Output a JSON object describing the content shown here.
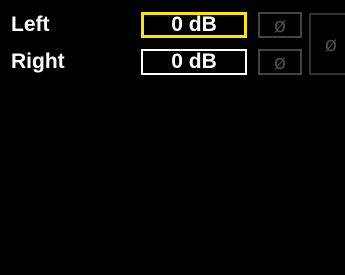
{
  "channels": {
    "left": {
      "label": "Left",
      "gain": "0 dB",
      "phase_symbol": "ø"
    },
    "right": {
      "label": "Right",
      "gain": "0 dB",
      "phase_symbol": "ø"
    }
  },
  "phase_all": {
    "symbol": "ø"
  },
  "colors": {
    "background": "#000000",
    "text": "#ffffff",
    "selected_border": "#ffe600",
    "disabled_text": "#4a4a4a",
    "disabled_border": "#444444"
  }
}
